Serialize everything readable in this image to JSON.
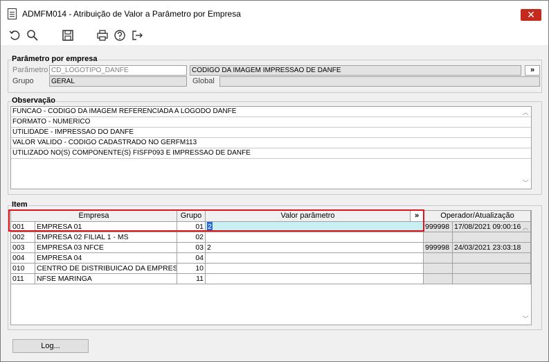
{
  "window": {
    "title": "ADMFM014 - Atribuição de Valor a Parâmetro por Empresa",
    "close_glyph": "✕"
  },
  "toolbar": {
    "icons": [
      "undo-icon",
      "search-icon",
      "save-icon",
      "print-icon",
      "help-icon",
      "exit-icon"
    ]
  },
  "param_section": {
    "title": "Parâmetro por empresa",
    "parametro_label": "Parâmetro",
    "parametro_value": "CD_LOGOTIPO_DANFE",
    "parametro_desc": "CODIGO DA IMAGEM IMPRESSAO DE DANFE",
    "more_label": "»",
    "grupo_label": "Grupo",
    "grupo_value": "GERAL",
    "global_label": "Global",
    "global_value": ""
  },
  "obs_section": {
    "title": "Observação",
    "lines": [
      "FUNCAO - CODIGO DA IMAGEM REFERENCIADA A LOGODO DANFE",
      "FORMATO - NUMERICO",
      "UTILIDADE - IMPRESSAO DO DANFE",
      "VALOR VALIDO - CODIGO CADASTRADO NO GERFM113",
      "UTILIZADO NO(S) COMPONENTE(S) FISFP093 E IMPRESSAO DE DANFE"
    ]
  },
  "item_section": {
    "title": "Item",
    "columns": {
      "empresa": "Empresa",
      "grupo": "Grupo",
      "valor": "Valor parâmetro",
      "valor_more": "»",
      "operador": "Operador/Atualização"
    },
    "rows": [
      {
        "code": "001",
        "empresa": "EMPRESA 01",
        "grupo": "01",
        "valor": "2",
        "operador": "999998",
        "data": "17/08/2021 09:00:16"
      },
      {
        "code": "002",
        "empresa": "EMPRESA 02 FILIAL 1 - MS",
        "grupo": "02",
        "valor": "",
        "operador": "",
        "data": ""
      },
      {
        "code": "003",
        "empresa": "EMPRESA 03 NFCE",
        "grupo": "03",
        "valor": "2",
        "operador": "999998",
        "data": "24/03/2021 23:03:18"
      },
      {
        "code": "004",
        "empresa": "EMPRESA 04",
        "grupo": "04",
        "valor": "",
        "operador": "",
        "data": ""
      },
      {
        "code": "010",
        "empresa": "CENTRO DE DISTRIBUICAO DA EMPRESA",
        "grupo": "10",
        "valor": "",
        "operador": "",
        "data": ""
      },
      {
        "code": "011",
        "empresa": "NFSE MARINGA",
        "grupo": "11",
        "valor": "",
        "operador": "",
        "data": ""
      }
    ]
  },
  "footer": {
    "log_label": "Log..."
  }
}
